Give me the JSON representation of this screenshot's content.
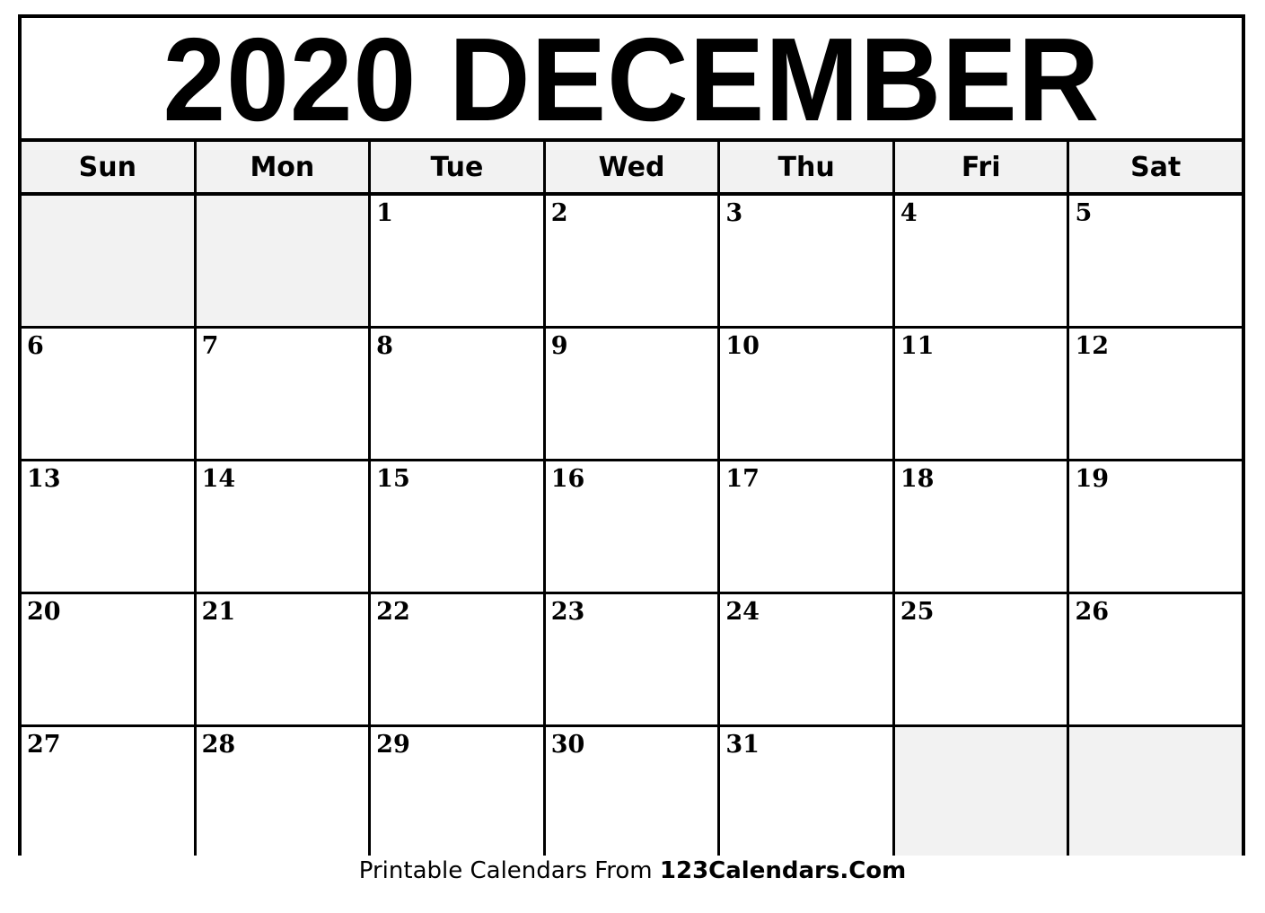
{
  "calendar": {
    "title": "2020 DECEMBER",
    "weekdays": [
      "Sun",
      "Mon",
      "Tue",
      "Wed",
      "Thu",
      "Fri",
      "Sat"
    ],
    "weeks": [
      [
        "",
        "",
        "1",
        "2",
        "3",
        "4",
        "5"
      ],
      [
        "6",
        "7",
        "8",
        "9",
        "10",
        "11",
        "12"
      ],
      [
        "13",
        "14",
        "15",
        "16",
        "17",
        "18",
        "19"
      ],
      [
        "20",
        "21",
        "22",
        "23",
        "24",
        "25",
        "26"
      ],
      [
        "27",
        "28",
        "29",
        "30",
        "31",
        "",
        ""
      ]
    ],
    "colors": {
      "border": "#000000",
      "header_fill": "#f2f2f2",
      "empty_fill": "#f2f2f2"
    }
  },
  "footer": {
    "prefix": "Printable Calendars From ",
    "brand": "123Calendars.Com"
  }
}
